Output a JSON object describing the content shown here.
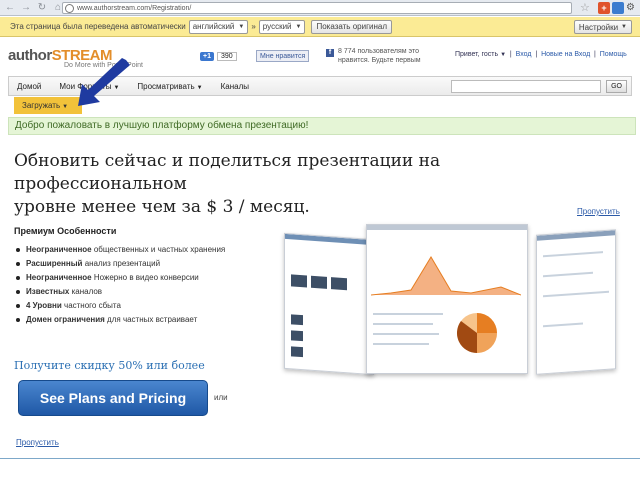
{
  "browser": {
    "url": "www.authorstream.com/Registration/",
    "ext_label": "+"
  },
  "translate_bar": {
    "message": "Эта страница была переведена автоматически",
    "from_lang": "английский",
    "arrow_sep": "»",
    "to_lang": "русский",
    "show_original": "Показать оригинал",
    "settings": "Настройки"
  },
  "header": {
    "logo_prefix": "author",
    "logo_brand": "STREAM",
    "tagline": "Do More with PowerPoint",
    "gplus_label": "+1",
    "gplus_count": "390",
    "fb_like": "Мне нравится",
    "fb_icon": "f",
    "fb_text": "8 774 пользователям это нравится. Будьте первым",
    "greeting": "Привет, гость",
    "link_login": "Вход",
    "link_new": "Новые на Вход",
    "link_help": "Помощь"
  },
  "nav": {
    "items": [
      "Домой",
      "Мои Форматы",
      "Просматривать",
      "Каналы"
    ],
    "go": "GO",
    "upload": "Загружать"
  },
  "welcome": "Добро пожаловать в лучшую платформу обмена презентацию!",
  "headline": {
    "line1": "Обновить сейчас и поделиться презентации на профессиональном",
    "line2": "уровне менее чем за $ 3 / месяц."
  },
  "skip_top": "Пропустить",
  "features": {
    "title": "Премиум Особенности",
    "items": [
      {
        "bold": "Неограниченное",
        "rest": " общественных и частных хранения"
      },
      {
        "bold": "Расширенный",
        "rest": " анализ презентаций"
      },
      {
        "bold": "Неограниченное",
        "rest": " Ножерно в видео конверсии"
      },
      {
        "bold": "Известных",
        "rest": " каналов"
      },
      {
        "bold": "4 Уровни",
        "rest": " частного сбыта"
      },
      {
        "bold": "Домен ограничения",
        "rest": " для частных встраивает"
      }
    ]
  },
  "discount": "Получите скидку 50% или более",
  "plans_button": "See Plans and Pricing",
  "or": "или",
  "skip_bottom": "Пропустить",
  "colors": {
    "translate_bg": "#fbeb95",
    "upload_bg": "#f2c23a",
    "welcome_bg": "#e5f5d6",
    "plans_btn": "#2a66b5",
    "arrow": "#1f3aa0"
  }
}
